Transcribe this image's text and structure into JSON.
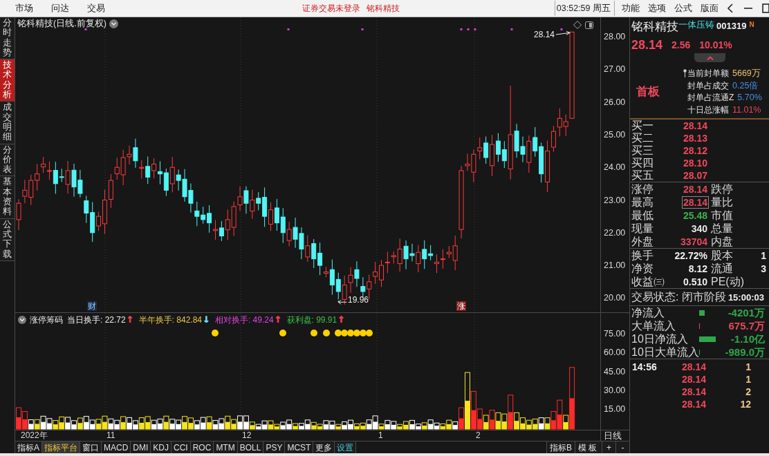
{
  "menu_bar": {
    "items": [
      "市场",
      "问达",
      "交易"
    ],
    "login_notice": "证券交易未登录",
    "stock_name": "铭科精技",
    "clock": "03:52:59 周五",
    "menus": [
      "功能",
      "选项",
      "公式",
      "版面"
    ]
  },
  "side_tabs": [
    {
      "label": "分时走势",
      "selected": false
    },
    {
      "label": "技术分析",
      "selected": true
    },
    {
      "label": "成交明细",
      "selected": false
    },
    {
      "label": "分价表",
      "selected": false
    },
    {
      "label": "基本资料",
      "selected": false
    },
    {
      "label": "公式下载",
      "selected": false
    }
  ],
  "price_chart": {
    "title": "铭科精技(日线.前复权)",
    "high_label": "28.14",
    "low_label": "19.96",
    "event_marks": [
      {
        "label": "财",
        "kind": "finance"
      },
      {
        "label": "涨",
        "kind": "limit_up"
      }
    ],
    "axis_labels": [
      "28.00",
      "27.00",
      "26.00",
      "25.00",
      "24.00",
      "23.00",
      "22.00",
      "21.00",
      "20.00"
    ]
  },
  "indicator": {
    "name": "涨停筹码",
    "readings": [
      {
        "label": "当日换手: 22.72",
        "color": "#f0f0f0",
        "arrow": {
          "symbol": "↑",
          "color": "#f03c4c"
        }
      },
      {
        "label": "半年换手: 842.84",
        "color": "#e8c64a",
        "arrow": {
          "symbol": "↓",
          "color": "#62d8f4"
        }
      },
      {
        "label": "相对换手: 49.24",
        "color": "#e043e0",
        "arrow": {
          "symbol": "↑",
          "color": "#f03c4c"
        }
      },
      {
        "label": "获利盘: 99.91",
        "color": "#3cc048",
        "arrow": {
          "symbol": "↑",
          "color": "#f03c4c"
        }
      }
    ],
    "axis_labels": [
      "75.00",
      "60.00",
      "45.00",
      "30.00",
      "15.00"
    ]
  },
  "time_axis": {
    "labels": [
      "2022年",
      "11",
      "12",
      "1",
      "2"
    ],
    "period": "日线"
  },
  "bottom_tabs": [
    {
      "label": "指标A",
      "selected": false,
      "kind": "tab"
    },
    {
      "label": "指标平台",
      "selected": true,
      "kind": "tab"
    },
    {
      "label": "窗口",
      "selected": false,
      "kind": "tab"
    },
    {
      "label": "MACD",
      "selected": false,
      "kind": "tab"
    },
    {
      "label": "DMI",
      "selected": false,
      "kind": "tab"
    },
    {
      "label": "KDJ",
      "selected": false,
      "kind": "tab"
    },
    {
      "label": "CCI",
      "selected": false,
      "kind": "tab"
    },
    {
      "label": "ROC",
      "selected": false,
      "kind": "tab"
    },
    {
      "label": "MTM",
      "selected": false,
      "kind": "tab"
    },
    {
      "label": "BOLL",
      "selected": false,
      "kind": "tab"
    },
    {
      "label": "PSY",
      "selected": false,
      "kind": "tab"
    },
    {
      "label": "MCST",
      "selected": false,
      "kind": "tab"
    },
    {
      "label": "更多",
      "selected": false,
      "kind": "tab"
    },
    {
      "label": "设置",
      "selected": false,
      "kind": "link"
    }
  ],
  "bottom_right_buttons": [
    "指标B",
    "模板",
    "+",
    "-"
  ],
  "quote_panel": {
    "name": "铭科精技",
    "concept": "一体压铸",
    "code": "001319",
    "badge": "N",
    "price": "28.14",
    "change": "2.56",
    "change_pct": "10.01%",
    "board": "首板",
    "seal_rows": [
      {
        "label": "当前封单额",
        "value": "5669万",
        "color": "#f0c070"
      },
      {
        "label": "封单占成交",
        "value": "0.25倍",
        "color": "#4a8ee0"
      },
      {
        "label": "封单占流通Z",
        "value": "5.70%",
        "color": "#4a8ee0"
      },
      {
        "label": "十日总涨幅",
        "value": "11.01%",
        "color": "#e8485a"
      }
    ],
    "bids": [
      {
        "label": "买一",
        "price": "28.14"
      },
      {
        "label": "买二",
        "price": "28.13"
      },
      {
        "label": "买三",
        "price": "28.12"
      },
      {
        "label": "买四",
        "price": "28.10"
      },
      {
        "label": "买五",
        "price": "28.07"
      }
    ],
    "stats": [
      {
        "label": "涨停",
        "value": "28.14",
        "color": "#e8485a",
        "highlighted": false,
        "label_2": "跌停"
      },
      {
        "label": "最高",
        "value": "28.14",
        "color": "#e8485a",
        "highlighted": true,
        "label_2": "量比"
      },
      {
        "label": "最低",
        "value": "25.48",
        "color": "#3cb050",
        "highlighted": false,
        "label_2": "市值"
      },
      {
        "label": "现量",
        "value": "340",
        "color": "#e8e8e8",
        "highlighted": false,
        "label_2": "总量"
      },
      {
        "label": "外盘",
        "value": "33704",
        "color": "#e8485a",
        "highlighted": false,
        "label_2": "内盘"
      }
    ],
    "shares": [
      {
        "label": "换手",
        "value": "22.72%",
        "label_2": "股本",
        "value_2": "1"
      },
      {
        "label": "净资",
        "value": "8.12",
        "label_2": "流通",
        "value_2": "3"
      },
      {
        "label": "收益㈢",
        "value": "0.510",
        "label_2": "PE(动)"
      }
    ],
    "status": "交易状态: 闭市阶段",
    "status_time": "15:00:03",
    "flows": [
      {
        "label": "净流入",
        "level": 0.33,
        "color": "#2ea84a",
        "value": "-4201万"
      },
      {
        "label": "大单流入",
        "level": 0.05,
        "color": "#e8485a",
        "value": "675.7万"
      },
      {
        "label": "10日净流入",
        "level": 1,
        "color": "#2ea84a",
        "value": "-1.10亿"
      },
      {
        "label": "10日大单流入",
        "level": 0.05,
        "color": "#2ea84a",
        "value": "-989.0万"
      }
    ],
    "trades": [
      {
        "time": "14:56",
        "price": "28.14",
        "volume": "1"
      },
      {
        "price": "28.14",
        "volume": "1"
      },
      {
        "price": "28.14",
        "volume": "2"
      },
      {
        "price": "28.14",
        "volume": "12"
      }
    ]
  }
}
